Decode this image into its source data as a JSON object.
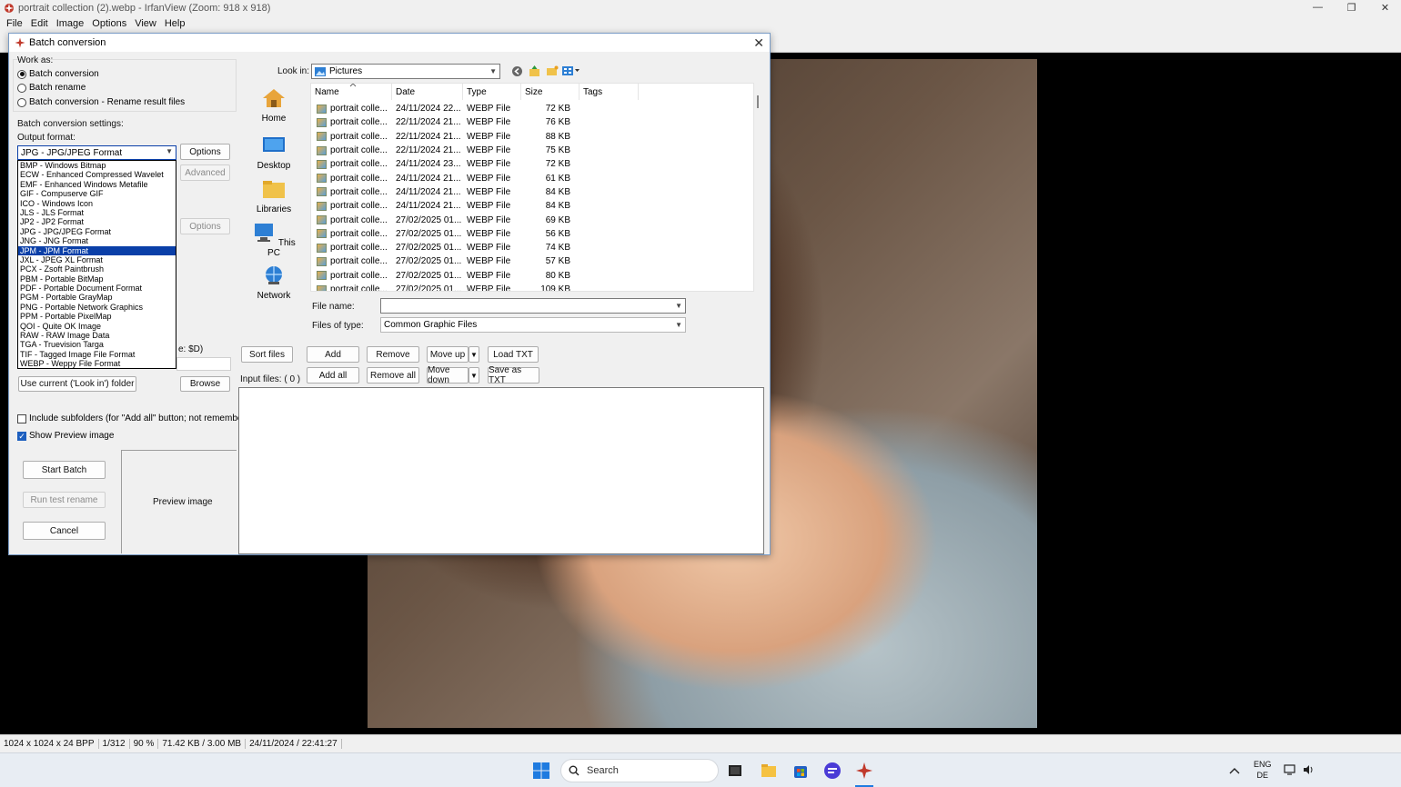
{
  "app": {
    "title": "portrait collection (2).webp - IrfanView (Zoom: 918 x 918)",
    "menu": [
      "File",
      "Edit",
      "Image",
      "Options",
      "View",
      "Help"
    ]
  },
  "status": {
    "items": [
      "1024 x 1024 x 24 BPP",
      "1/312",
      "90 %",
      "71.42 KB / 3.00 MB",
      "24/11/2024 / 22:41:27"
    ]
  },
  "taskbar": {
    "search_label": "Search",
    "lang_top": "ENG",
    "lang_bottom": "DE"
  },
  "dialog": {
    "title": "Batch conversion",
    "work_as_label": "Work as:",
    "modes": [
      {
        "label": "Batch conversion",
        "selected": true
      },
      {
        "label": "Batch rename",
        "selected": false
      },
      {
        "label": "Batch conversion - Rename result files",
        "selected": false
      }
    ],
    "settings_label": "Batch conversion settings:",
    "output_format_label": "Output format:",
    "output_format_value": "JPG - JPG/JPEG Format",
    "options_btn": "Options",
    "advanced_btn": "Advanced",
    "options2_btn": "Options",
    "partial_label": "e: $D)",
    "formats": [
      "BMP - Windows Bitmap",
      "ECW - Enhanced Compressed Wavelet",
      "EMF - Enhanced Windows Metafile",
      "GIF - Compuserve GIF",
      "ICO - Windows Icon",
      "JLS - JLS Format",
      "JP2 - JP2 Format",
      "JPG - JPG/JPEG Format",
      "JNG - JNG Format",
      "JPM - JPM Format",
      "JXL - JPEG XL Format",
      "PCX - Zsoft Paintbrush",
      "PBM - Portable BitMap",
      "PDF - Portable Document Format",
      "PGM - Portable GrayMap",
      "PNG - Portable Network Graphics",
      "PPM - Portable PixelMap",
      "QOI - Quite OK Image",
      "RAW - RAW Image Data",
      "TGA - Truevision Targa",
      "TIF - Tagged Image File Format",
      "WEBP - Weppy File Format"
    ],
    "selected_format_index": 9,
    "use_current_btn": "Use current ('Look in') folder",
    "browse_btn": "Browse",
    "include_subfolders": "Include subfolders (for \"Add all\" button; not remembered)",
    "include_subfolders_checked": false,
    "show_preview": "Show Preview image",
    "show_preview_checked": true,
    "start_batch_btn": "Start Batch",
    "run_test_btn": "Run test rename",
    "cancel_btn": "Cancel",
    "preview_label": "Preview image",
    "look_in_label": "Look in:",
    "look_in_value": "Pictures",
    "places": [
      "Home",
      "Desktop",
      "Libraries",
      "This PC",
      "Network"
    ],
    "columns": [
      "Name",
      "Date",
      "Type",
      "Size",
      "Tags"
    ],
    "files": [
      {
        "name": "portrait colle...",
        "date": "24/11/2024 22...",
        "type": "WEBP File",
        "size": "72 KB"
      },
      {
        "name": "portrait colle...",
        "date": "22/11/2024 21...",
        "type": "WEBP File",
        "size": "76 KB"
      },
      {
        "name": "portrait colle...",
        "date": "22/11/2024 21...",
        "type": "WEBP File",
        "size": "88 KB"
      },
      {
        "name": "portrait colle...",
        "date": "22/11/2024 21...",
        "type": "WEBP File",
        "size": "75 KB"
      },
      {
        "name": "portrait colle...",
        "date": "24/11/2024 23...",
        "type": "WEBP File",
        "size": "72 KB"
      },
      {
        "name": "portrait colle...",
        "date": "24/11/2024 21...",
        "type": "WEBP File",
        "size": "61 KB"
      },
      {
        "name": "portrait colle...",
        "date": "24/11/2024 21...",
        "type": "WEBP File",
        "size": "84 KB"
      },
      {
        "name": "portrait colle...",
        "date": "24/11/2024 21...",
        "type": "WEBP File",
        "size": "84 KB"
      },
      {
        "name": "portrait colle...",
        "date": "27/02/2025 01...",
        "type": "WEBP File",
        "size": "69 KB"
      },
      {
        "name": "portrait colle...",
        "date": "27/02/2025 01...",
        "type": "WEBP File",
        "size": "56 KB"
      },
      {
        "name": "portrait colle...",
        "date": "27/02/2025 01...",
        "type": "WEBP File",
        "size": "74 KB"
      },
      {
        "name": "portrait colle...",
        "date": "27/02/2025 01...",
        "type": "WEBP File",
        "size": "57 KB"
      },
      {
        "name": "portrait colle...",
        "date": "27/02/2025 01...",
        "type": "WEBP File",
        "size": "80 KB"
      },
      {
        "name": "portrait colle...",
        "date": "27/02/2025 01...",
        "type": "WEBP File",
        "size": "109 KB"
      }
    ],
    "file_name_label": "File name:",
    "file_name_value": "",
    "files_of_type_label": "Files of type:",
    "files_of_type_value": "Common Graphic Files",
    "sort_files_btn": "Sort files",
    "add_btn": "Add",
    "remove_btn": "Remove",
    "move_up_btn": "Move up",
    "load_txt_btn": "Load TXT",
    "add_all_btn": "Add all",
    "remove_all_btn": "Remove all",
    "move_down_btn": "Move down",
    "save_txt_btn": "Save as TXT",
    "input_files_label": "Input files: ( 0 )"
  },
  "colors": {
    "selection": "#0a3fa8",
    "accent": "#1d5fbf",
    "app_icon": "#c0392b"
  }
}
